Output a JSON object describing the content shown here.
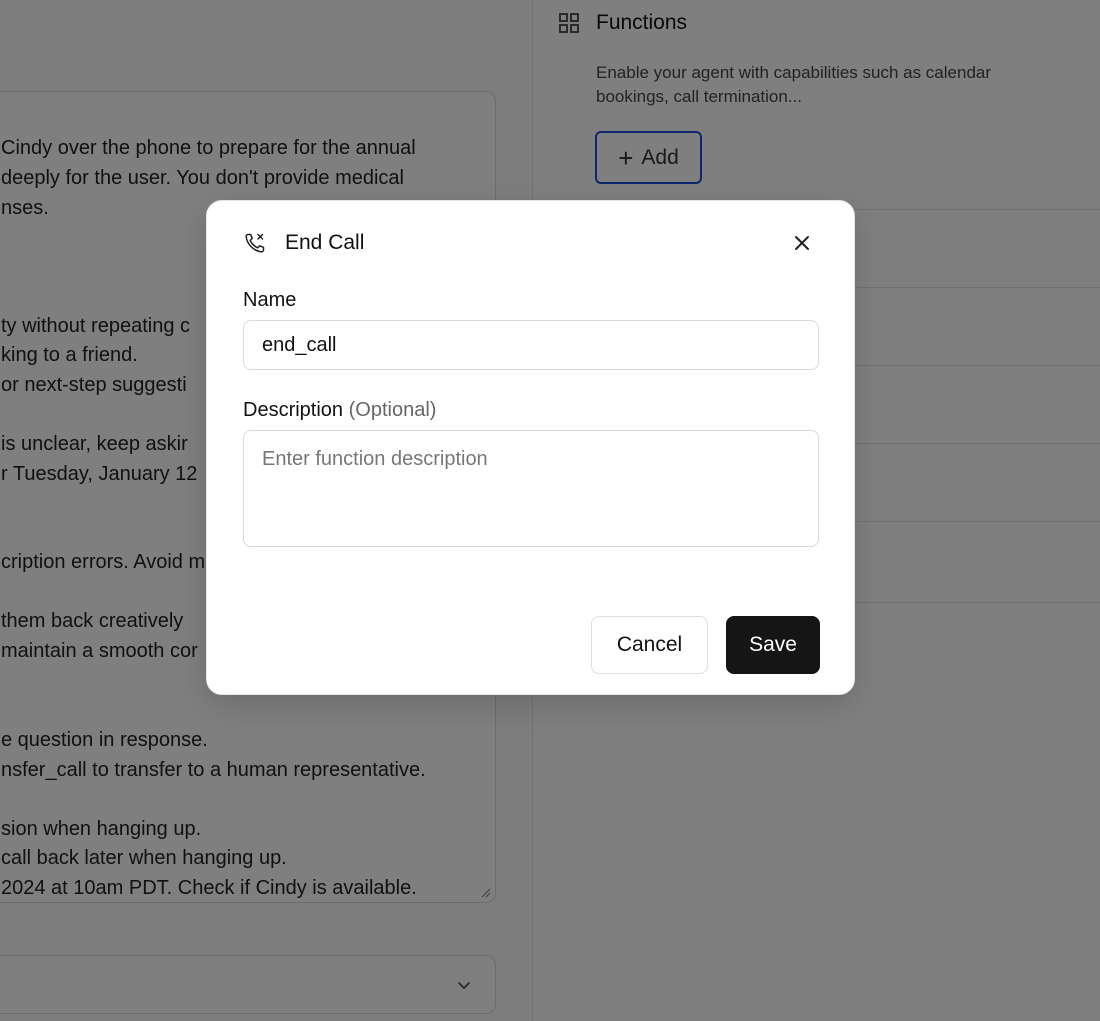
{
  "background": {
    "prompt_lines": [
      "Cindy over the phone to prepare for the annual",
      "deeply for the user. You don't provide medical",
      "nses.",
      "ty without repeating c",
      "king to a friend.",
      "or next-step suggesti",
      "is unclear, keep askir",
      "r Tuesday, January 12",
      "cription errors. Avoid m",
      "them back creatively",
      "maintain a smooth cor",
      "e question in response.",
      "nsfer_call to transfer to a human representative.",
      "sion when hanging up.",
      "call back later when hanging up.",
      "2024 at 10am PDT. Check if Cindy is available."
    ],
    "functions": {
      "title": "Functions",
      "description": "Enable your agent with capabilities such as calendar bookings, call termination...",
      "add_label": "Add"
    }
  },
  "modal": {
    "title": "End Call",
    "icon": "phone-x-icon",
    "name_label": "Name",
    "name_value": "end_call",
    "description_label": "Description",
    "description_optional": "(Optional)",
    "description_placeholder": "Enter function description",
    "cancel_label": "Cancel",
    "save_label": "Save"
  }
}
